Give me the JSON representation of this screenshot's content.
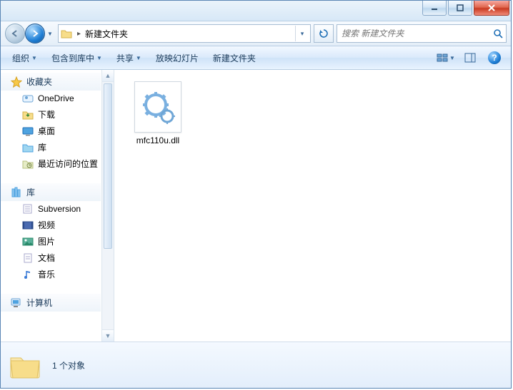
{
  "titlebar": {},
  "nav": {
    "path_label": "新建文件夹",
    "search_placeholder": "搜索 新建文件夹"
  },
  "toolbar": {
    "organize": "组织",
    "include": "包含到库中",
    "share": "共享",
    "slideshow": "放映幻灯片",
    "new_folder": "新建文件夹"
  },
  "sidebar": {
    "favorites_label": "收藏夹",
    "favorites": [
      {
        "label": "OneDrive",
        "icon": "onedrive"
      },
      {
        "label": "下载",
        "icon": "download"
      },
      {
        "label": "桌面",
        "icon": "desktop"
      },
      {
        "label": "库",
        "icon": "library"
      },
      {
        "label": "最近访问的位置",
        "icon": "recent"
      }
    ],
    "libraries_label": "库",
    "libraries": [
      {
        "label": "Subversion",
        "icon": "svn"
      },
      {
        "label": "视频",
        "icon": "video"
      },
      {
        "label": "图片",
        "icon": "pictures"
      },
      {
        "label": "文档",
        "icon": "documents"
      },
      {
        "label": "音乐",
        "icon": "music"
      }
    ],
    "computer_label": "计算机"
  },
  "content": {
    "files": [
      {
        "name": "mfc110u.dll",
        "icon": "dll"
      }
    ]
  },
  "status": {
    "count_label": "1 个对象"
  }
}
